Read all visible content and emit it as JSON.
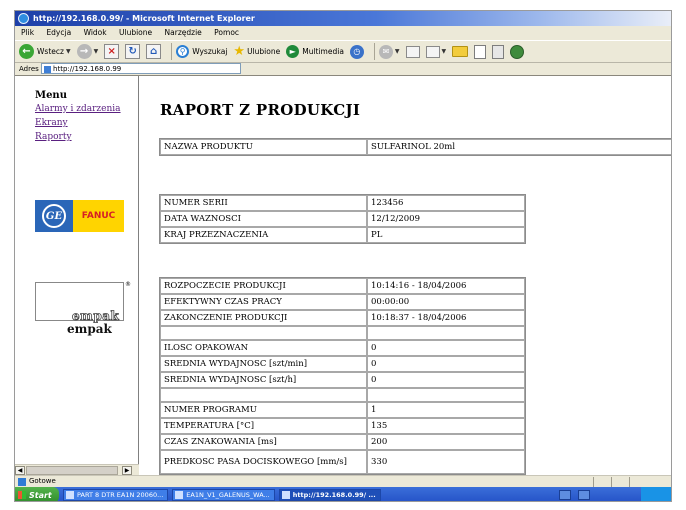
{
  "window": {
    "title": "http://192.168.0.99/ - Microsoft Internet Explorer"
  },
  "menubar": [
    "Plik",
    "Edycja",
    "Widok",
    "Ulubione",
    "Narzędzie",
    "Pomoc"
  ],
  "toolbar": {
    "back_label": "Wstecz",
    "search_label": "Wyszukaj",
    "favorites_label": "Ulubione",
    "multimedia_label": "Multimedia"
  },
  "address": {
    "label": "Adres",
    "url": "http://192.168.0.99"
  },
  "sidebar": {
    "title": "Menu",
    "links": [
      "Alarmy i zdarzenia",
      "Ekrany",
      "Raporty"
    ],
    "logo_ge_text": "GE",
    "logo_fanuc_text": "FANUC",
    "logo_empak_text": "empak"
  },
  "report": {
    "title": "RAPORT Z PRODUKCJI",
    "product": {
      "label": "NAZWA PRODUKTU",
      "value": "SULFARINOL 20ml"
    },
    "batch": [
      {
        "label": "NUMER SERII",
        "value": "123456"
      },
      {
        "label": "DATA WAZNOSCI",
        "value": "12/12/2009"
      },
      {
        "label": "KRAJ PRZEZNACZENIA",
        "value": "PL"
      }
    ],
    "production": [
      {
        "label": "ROZPOCZECIE PRODUKCJI",
        "value": "10:14:16 - 18/04/2006"
      },
      {
        "label": "EFEKTYWNY CZAS PRACY",
        "value": "00:00:00"
      },
      {
        "label": "ZAKONCZENIE PRODUKCJI",
        "value": "10:18:37 - 18/04/2006"
      }
    ],
    "output": [
      {
        "label": "ILOSC OPAKOWAN",
        "value": "0"
      },
      {
        "label": "SREDNIA WYDAJNOSC [szt/min]",
        "value": "0"
      },
      {
        "label": "SREDNIA WYDAJNOSC [szt/h]",
        "value": "0"
      }
    ],
    "program": [
      {
        "label": "NUMER PROGRAMU",
        "value": "1"
      },
      {
        "label": "TEMPERATURA [°C]",
        "value": "135"
      },
      {
        "label": "CZAS ZNAKOWANIA [ms]",
        "value": "200"
      },
      {
        "label": "PREDKOSC PASA DOCISKOWEGO [mm/s]",
        "value": "330"
      }
    ]
  },
  "statusbar": {
    "text": "Gotowe"
  },
  "taskbar": {
    "start_label": "Start",
    "tasks": [
      "PART 8 DTR EA1N 20060...",
      "EA1N_V1_GALENUS_WA...",
      "http://192.168.0.99/ ..."
    ]
  }
}
